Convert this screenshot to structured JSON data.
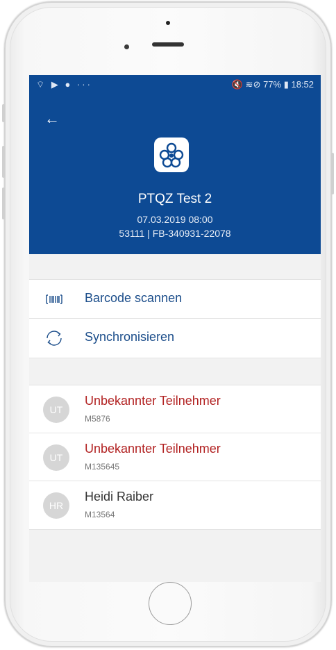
{
  "statusbar": {
    "left_icons": "⌔ ▶ ● ···",
    "right_text": "🔇 ≋⊘ 77% ▮ 18:52"
  },
  "header": {
    "title": "PTQZ Test 2",
    "date": "07.03.2019 08:00",
    "code": "53111 | FB-340931-22078"
  },
  "actions": [
    {
      "label": "Barcode scannen",
      "icon": "barcode-icon"
    },
    {
      "label": "Synchronisieren",
      "icon": "sync-icon"
    }
  ],
  "participants": [
    {
      "initials": "UT",
      "name": "Unbekannter Teilnehmer",
      "id": "M5876",
      "status": "unknown"
    },
    {
      "initials": "UT",
      "name": "Unbekannter Teilnehmer",
      "id": "M135645",
      "status": "unknown"
    },
    {
      "initials": "HR",
      "name": "Heidi Raiber",
      "id": "M13564",
      "status": "known"
    }
  ],
  "colors": {
    "header_bg": "#0d4a94",
    "accent_text": "#1b4d8a",
    "unknown_name": "#b22222",
    "avatar_bg": "#d6d6d6"
  }
}
